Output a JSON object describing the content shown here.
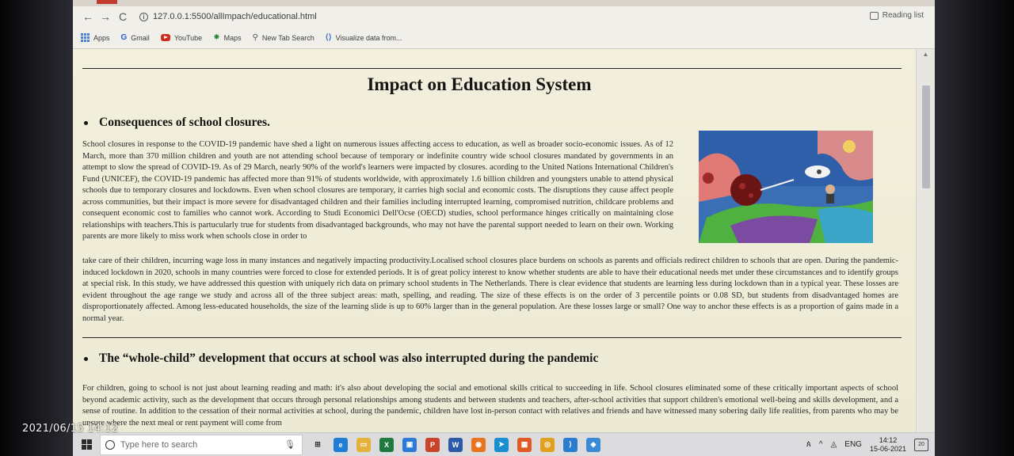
{
  "browser": {
    "url": "127.0.0.1:5500/allImpach/educational.html",
    "reading_list": "Reading list",
    "bookmarks": [
      {
        "label": "Apps",
        "icon": "apps-grid-icon"
      },
      {
        "label": "Gmail",
        "icon": "google-g-icon"
      },
      {
        "label": "YouTube",
        "icon": "youtube-icon"
      },
      {
        "label": "Maps",
        "icon": "maps-icon"
      },
      {
        "label": "New Tab Search",
        "icon": "search-icon"
      },
      {
        "label": "Visualize data from...",
        "icon": "code-brackets-icon"
      }
    ]
  },
  "page": {
    "title": "Impact on Education System",
    "section1_heading": "Consequences of school closures.",
    "section1_para_a": "School closures in response to the COVID-19 pandemic have shed a light on numerous issues affecting access to education, as well as broader socio-economic issues. As of 12 March, more than 370 million children and youth are not attending school because of temporary or indefinite country wide school closures mandated by governments in an attempt to slow the spread of COVID-19. As of 29 March, nearly 90% of the world's learners were impacted by closures. acording to the United Nations International Children's Fund (UNICEF), the COVID-19 pandemic has affected more than 91% of students worldwide, with approximately 1.6 billion children and youngsters unable to attend physical schools due to temporary closures and lockdowns. Even when school closures are temporary, it carries high social and economic costs. The disruptions they cause affect people across communities, but their impact is more severe for disadvantaged children and their families including interrupted learning, compromised nutrition, childcare problems and consequent economic cost to families who cannot work. According to Studi Economici Dell'Ocse (OECD) studies, school performance hinges critically on maintaining close relationships with teachers.This is partucularly true for students from disadvantaged backgrounds, who may not have the parental support needed to learn on their own. Working parents are more likely to miss work when schools close in order to",
    "section1_para_b": "take care of their children, incurring wage loss in many instances and negatively impacting productivity.Localised school closures place burdens on schools as parents and officials redirect children to schools that are open. During the pandemic-induced lockdown in 2020, schools in many countries were forced to close for extended periods. It is of great policy interest to know whether students are able to have their educational needs met under these circumstances and to identify groups at special risk. In this study, we have addressed this question with uniquely rich data on primary school students in The Netherlands. There is clear evidence that students are learning less during lockdown than in a typical year. These losses are evident throughout the age range we study and across all of the three subject areas: math, spelling, and reading. The size of these effects is on the order of 3 percentile points or 0.08 SD, but students from disadvantaged homes are disproportionately affected. Among less-educated households, the size of the learning slide is up to 60% larger than in the general population. Are these losses large or small? One way to anchor these effects is as a proportion of gains made in a normal year.",
    "section2_heading": "The “whole-child” development that occurs at school was also interrupted during the pandemic",
    "section2_para": "For children, going to school is not just about learning reading and math: it's also about developing the social and emotional skills critical to succeeding in life. School closures eliminated some of these critically important aspects of school beyond academic activity, such as the development that occurs through personal relationships among students and between students and teachers, after-school activities that support children's emotional well-being and skills development, and a sense of routine. In addition to the cessation of their normal activities at school, during the pandemic, children have lost in-person contact with relatives and friends and have witnessed many sobering daily life realities, from parents who may be unsure where the next meal or rent payment will come from"
  },
  "taskbar": {
    "search_placeholder": "Type here to search",
    "lang": "ENG",
    "time": "14:12",
    "date": "15-06-2021",
    "notification_count": "20"
  },
  "photo_timestamp": "2021/06/15 14:12"
}
